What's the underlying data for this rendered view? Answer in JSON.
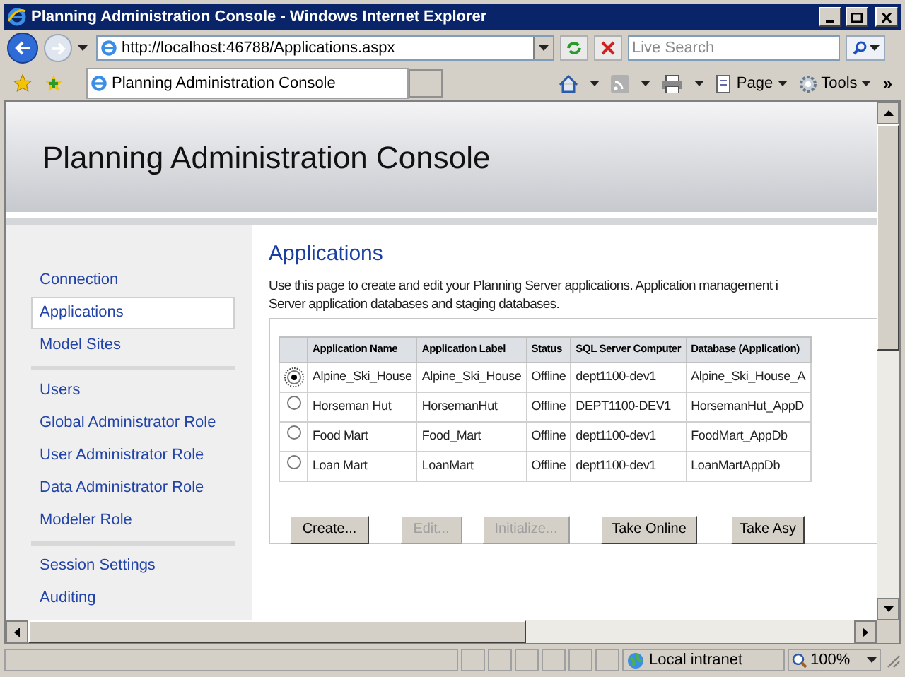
{
  "window": {
    "title": "Planning Administration Console - Windows Internet Explorer"
  },
  "address_bar": {
    "url": "http://localhost:46788/Applications.aspx"
  },
  "search": {
    "placeholder": "Live Search"
  },
  "tab": {
    "label": "Planning Administration Console",
    "selected": true
  },
  "command_bar": {
    "page": "Page",
    "tools": "Tools",
    "overflow": "»"
  },
  "banner": {
    "title": "Planning Administration Console"
  },
  "sidebar": {
    "groups": [
      [
        {
          "label": "Connection",
          "selected": false
        },
        {
          "label": "Applications",
          "selected": true
        },
        {
          "label": "Model Sites",
          "selected": false
        }
      ],
      [
        {
          "label": "Users",
          "selected": false
        },
        {
          "label": "Global Administrator Role",
          "selected": false
        },
        {
          "label": "User Administrator Role",
          "selected": false
        },
        {
          "label": "Data Administrator Role",
          "selected": false
        },
        {
          "label": "Modeler Role",
          "selected": false
        }
      ],
      [
        {
          "label": "Session Settings",
          "selected": false
        },
        {
          "label": "Auditing",
          "selected": false
        }
      ]
    ]
  },
  "page": {
    "heading": "Applications",
    "description_lines": [
      "Use this page to create and edit your Planning Server applications. Application management i",
      "Server application databases and staging databases."
    ]
  },
  "table": {
    "columns": [
      "Application Name",
      "Application Label",
      "Status",
      "SQL Server Computer",
      "Database (Application)"
    ],
    "rows": [
      {
        "selected": true,
        "cells": [
          "Alpine_Ski_House",
          "Alpine_Ski_House",
          "Offline",
          "dept1100-dev1",
          "Alpine_Ski_House_A"
        ]
      },
      {
        "selected": false,
        "cells": [
          "Horseman Hut",
          "HorsemanHut",
          "Offline",
          "DEPT1100-DEV1",
          "HorsemanHut_AppD"
        ]
      },
      {
        "selected": false,
        "cells": [
          "Food Mart",
          "Food_Mart",
          "Offline",
          "dept1100-dev1",
          "FoodMart_AppDb"
        ]
      },
      {
        "selected": false,
        "cells": [
          "Loan Mart",
          "LoanMart",
          "Offline",
          "dept1100-dev1",
          "LoanMartAppDb"
        ]
      }
    ]
  },
  "buttons": [
    {
      "label": "Create...",
      "disabled": false
    },
    {
      "label": "Edit...",
      "disabled": true
    },
    {
      "label": "Initialize...",
      "disabled": true
    },
    {
      "label": "Take Online",
      "disabled": false
    },
    {
      "label": "Take Asy",
      "disabled": false
    }
  ],
  "status_bar": {
    "zone": "Local intranet",
    "zoom": "100%"
  }
}
